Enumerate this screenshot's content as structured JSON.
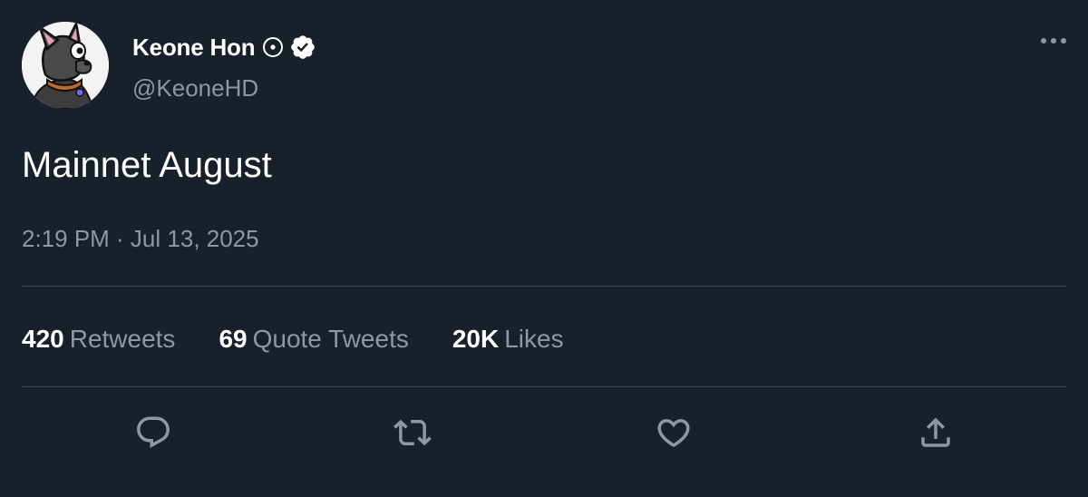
{
  "author": {
    "display_name": "Keone Hon",
    "handle": "@KeoneHD",
    "avatar": "cartoon-dog-avatar",
    "icons": [
      "affiliation-circle-icon",
      "verified-badge-icon"
    ]
  },
  "tweet": {
    "text": "Mainnet August",
    "timestamp": "2:19 PM · Jul 13, 2025"
  },
  "stats": [
    {
      "count": "420",
      "label": "Retweets"
    },
    {
      "count": "69",
      "label": "Quote Tweets"
    },
    {
      "count": "20K",
      "label": "Likes"
    }
  ],
  "actions": [
    "reply-icon",
    "retweet-icon",
    "like-icon",
    "share-icon"
  ],
  "colors": {
    "background": "#17202b",
    "primary_text": "#ffffff",
    "secondary_text": "#8b98a5",
    "divider": "#38444d"
  }
}
